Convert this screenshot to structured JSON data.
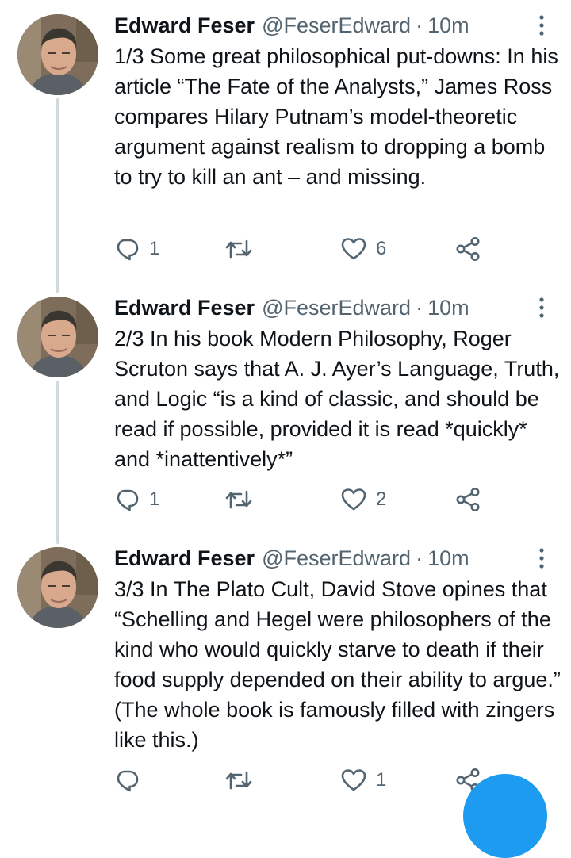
{
  "tweets": [
    {
      "author": "Edward Feser",
      "handle": "@FeserEdward",
      "separator": "·",
      "time": "10m",
      "text": "1/3 Some great philosophical put-downs: In his article “The Fate of the Analysts,” James Ross compares Hilary Putnam’s model-theoretic argument against realism to dropping a bomb to try to kill an ant – and missing.",
      "replies": "1",
      "retweets": "",
      "likes": "6"
    },
    {
      "author": "Edward Feser",
      "handle": "@FeserEdward",
      "separator": "·",
      "time": "10m",
      "text": "2/3 In his book Modern Philosophy, Roger Scruton says that A. J. Ayer’s Language, Truth, and Logic “is a kind of classic, and should be read if possible, provided it is read *quickly* and *inattentively*”",
      "replies": "1",
      "retweets": "",
      "likes": "2"
    },
    {
      "author": "Edward Feser",
      "handle": "@FeserEdward",
      "separator": "·",
      "time": "10m",
      "text": "3/3 In The Plato Cult, David Stove opines that “Schelling and Hegel were philosophers of the kind who would quickly starve to death if their food supply depended on their ability to argue.” (The whole book is famously filled with zingers like this.)",
      "replies": "",
      "retweets": "",
      "likes": "1"
    }
  ],
  "icons": {
    "reply": "reply-icon",
    "retweet": "retweet-icon",
    "like": "heart-icon",
    "share": "share-icon",
    "more": "more-vertical-icon"
  },
  "colors": {
    "text": "#0f1419",
    "secondary": "#536471",
    "thread_line": "#cfd9de",
    "accent": "#1d9bf0"
  }
}
